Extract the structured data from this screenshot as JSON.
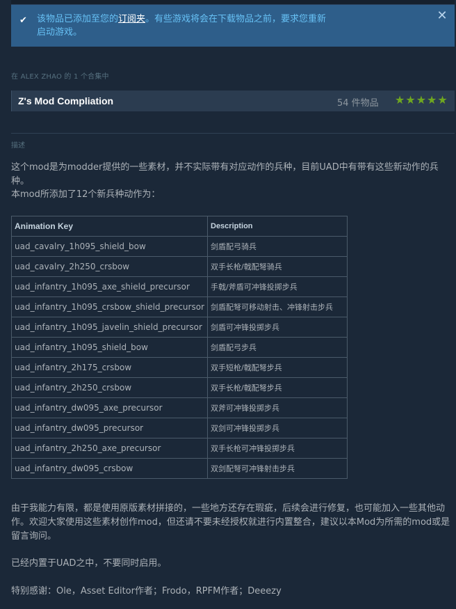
{
  "notice": {
    "message_before": "该物品已添加至您的",
    "message_link": "订阅夹",
    "message_after": "。有些游戏将会在下载物品之前，要求您重新启动游戏。",
    "check_icon": "checkmark-icon",
    "close_icon": "close-icon",
    "close_glyph": "✕"
  },
  "collection": {
    "label": "在 ALEX ZHAO 的 1 个合集中",
    "name": "Z's Mod Compliation",
    "count": "54 件物品",
    "stars": "★★★★★",
    "rating": 5,
    "star_color": "#6fa720"
  },
  "description": {
    "label": "描述",
    "intro": "这个mod是为modder提供的一些素材，并不实际带有对应动作的兵种，目前UAD中有带有这些新动作的兵种。",
    "added": "本mod所添加了12个新兵种动作为：",
    "table": {
      "headers": [
        "Animation Key",
        "Description"
      ],
      "rows": [
        [
          "uad_cavalry_1h095_shield_bow",
          "剑盾配弓骑兵"
        ],
        [
          "uad_cavalry_2h250_crsbow",
          "双手长枪/戟配弩骑兵"
        ],
        [
          "uad_infantry_1h095_axe_shield_precursor",
          "手戟/斧盾可冲锋投掷步兵"
        ],
        [
          "uad_infantry_1h095_crsbow_shield_precursor",
          "剑盾配弩可移动射击、冲锋射击步兵"
        ],
        [
          "uad_infantry_1h095_javelin_shield_precursor",
          "剑盾可冲锋投掷步兵"
        ],
        [
          "uad_infantry_1h095_shield_bow",
          "剑盾配弓步兵"
        ],
        [
          "uad_infantry_2h175_crsbow",
          "双手短枪/戟配弩步兵"
        ],
        [
          "uad_infantry_2h250_crsbow",
          "双手长枪/戟配弩步兵"
        ],
        [
          "uad_infantry_dw095_axe_precursor",
          "双斧可冲锋投掷步兵"
        ],
        [
          "uad_infantry_dw095_precursor",
          "双剑可冲锋投掷步兵"
        ],
        [
          "uad_infantry_2h250_axe_precursor",
          "双手长枪可冲锋投掷步兵"
        ],
        [
          "uad_infantry_dw095_crsbow",
          "双剑配弩可冲锋射击步兵"
        ]
      ]
    },
    "limits": "由于我能力有限，都是使用原版素材拼接的，一些地方还存在瑕疵，后续会进行修复，也可能加入一些其他动作。欢迎大家使用这些素材创作mod，但还请不要未经授权就进行内置整合，建议以本Mod为所需的mod或是留言询问。",
    "builtin": "已经内置于UAD之中，不要同时启用。",
    "thanks": "特别感谢：Ole，Asset Editor作者；Frodo，RPFM作者；Deeezy"
  }
}
